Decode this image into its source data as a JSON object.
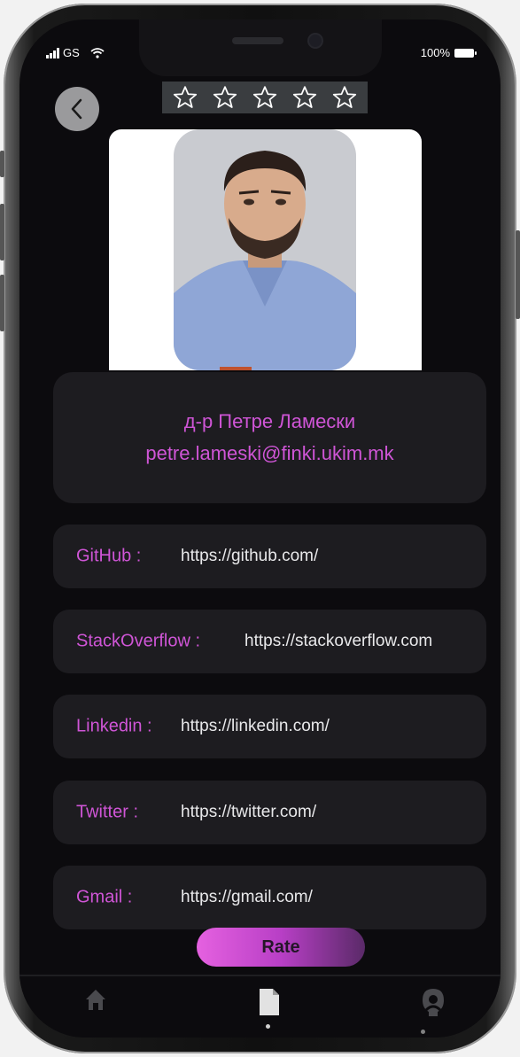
{
  "status_bar": {
    "carrier": "GS",
    "battery": "100%"
  },
  "rating": {
    "max_stars": 5,
    "filled": 0
  },
  "profile": {
    "name": "д-р Петре Ламески",
    "email": "petre.lameski@finki.ukim.mk"
  },
  "links": [
    {
      "label": "GitHub :",
      "url": "https://github.com/"
    },
    {
      "label": "StackOverflow :",
      "url": "https://stackoverflow.com"
    },
    {
      "label": "Linkedin :",
      "url": "https://linkedin.com/"
    },
    {
      "label": "Twitter :",
      "url": "https://twitter.com/"
    },
    {
      "label": "Gmail :",
      "url": "https://gmail.com/"
    }
  ],
  "rate_button": {
    "label": "Rate"
  },
  "nav": [
    {
      "icon": "home-icon"
    },
    {
      "icon": "document-icon",
      "active": true
    },
    {
      "icon": "profile-icon"
    }
  ],
  "colors": {
    "accent": "#cf55d6",
    "card": "#1d1c20",
    "background": "#0c0b0e"
  }
}
